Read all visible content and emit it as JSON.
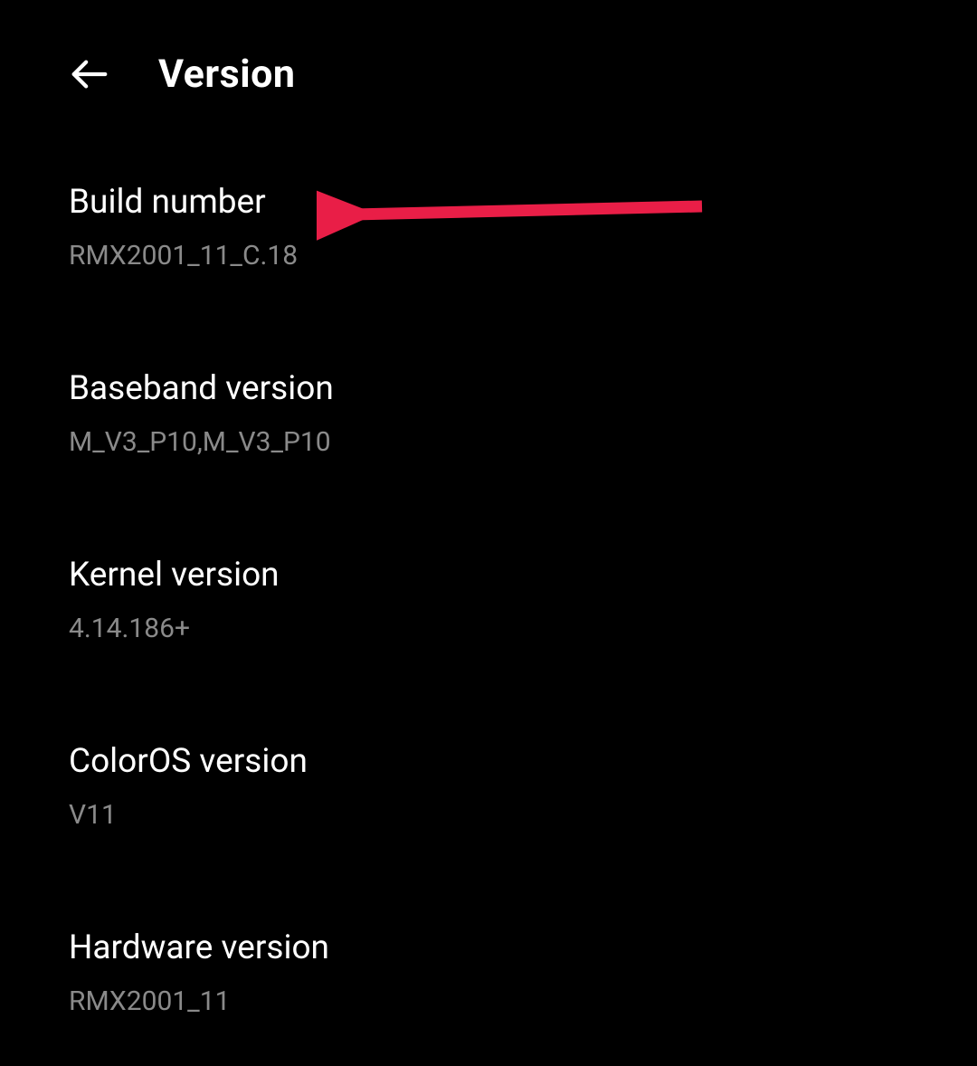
{
  "header": {
    "title": "Version"
  },
  "items": [
    {
      "label": "Build number",
      "value": "RMX2001_11_C.18"
    },
    {
      "label": "Baseband version",
      "value": "M_V3_P10,M_V3_P10"
    },
    {
      "label": "Kernel version",
      "value": "4.14.186+"
    },
    {
      "label": "ColorOS version",
      "value": "V11"
    },
    {
      "label": "Hardware version",
      "value": "RMX2001_11"
    }
  ],
  "annotation": {
    "arrow_color": "#dc3545"
  }
}
